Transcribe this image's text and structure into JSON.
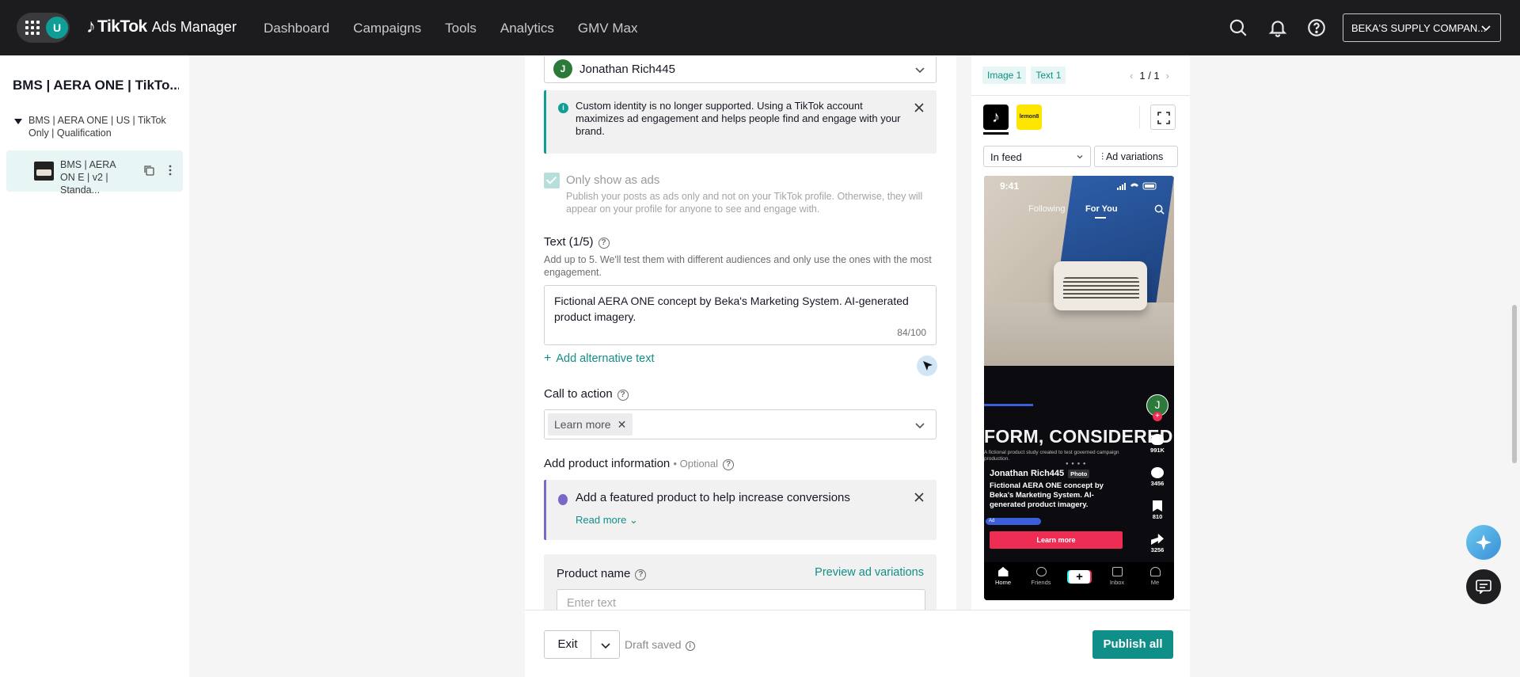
{
  "topbar": {
    "avatar_initial": "U",
    "brand_tiktok": "TikTok",
    "brand_product": "Ads Manager",
    "nav": [
      "Dashboard",
      "Campaigns",
      "Tools",
      "Analytics",
      "GMV Max"
    ],
    "account": "BEKA'S SUPPLY COMPAN..."
  },
  "sidebar": {
    "title": "BMS | AERA ONE | TikTo...",
    "group": "BMS | AERA ONE | US | TikTok Only | Qualification",
    "ad": "BMS | AERA ON E | v2 | Standa..."
  },
  "form": {
    "identity": {
      "initial": "J",
      "name": "Jonathan Rich445"
    },
    "info_notice": "Custom identity is no longer supported. Using a TikTok account maximizes ad engagement and helps people find and engage with your brand.",
    "only_ads_label": "Only show as ads",
    "only_ads_help": "Publish your posts as ads only and not on your TikTok profile. Otherwise, they will appear on your profile for anyone to see and engage with.",
    "text_label": "Text (1/5)",
    "text_help": "Add up to 5. We'll test them with different audiences and only use the ones with the most engagement.",
    "text_value": "Fictional AERA ONE concept by Beka's Marketing System. AI-generated product imagery.",
    "text_count": "84/100",
    "add_alt_text": "Add alternative text",
    "cta_label": "Call to action",
    "cta_value": "Learn more",
    "product_info_label": "Add product information",
    "optional": "Optional",
    "product_notice": "Add a featured product to help increase conversions",
    "read_more": "Read more",
    "product_name_label": "Product name",
    "preview_variations": "Preview ad variations",
    "product_name_placeholder": "Enter text"
  },
  "footer": {
    "exit": "Exit",
    "draft_status": "Draft saved",
    "publish": "Publish all"
  },
  "preview": {
    "tabs": [
      "Image 1",
      "Text 1"
    ],
    "page_current": "1",
    "page_total": "1",
    "lemon_logo": "lemon8",
    "placement": "In feed",
    "ad_variations": "Ad variations",
    "phone": {
      "time": "9:41",
      "tab_following": "Following",
      "tab_foryou": "For You",
      "headline": "FORM, CONSIDERED",
      "small_text": "A fictional product study created to test governed campaign production.",
      "dots": "● ● ● ●",
      "username": "Jonathan Rich445",
      "photo_badge": "Photo",
      "caption": "Fictional AERA ONE concept by Beka's Marketing System. AI-generated product imagery.",
      "ad_badge": "Ad",
      "cta": "Learn more",
      "avatar_initial": "J",
      "likes": "991K",
      "comments": "3456",
      "saves": "810",
      "shares": "3256",
      "nav": [
        "Home",
        "Friends",
        "+",
        "Inbox",
        "Me"
      ]
    }
  },
  "colors": {
    "accent": "#0f8f88",
    "topbar_bg": "#1c1c1e",
    "tiktok_red": "#ee2d55"
  }
}
